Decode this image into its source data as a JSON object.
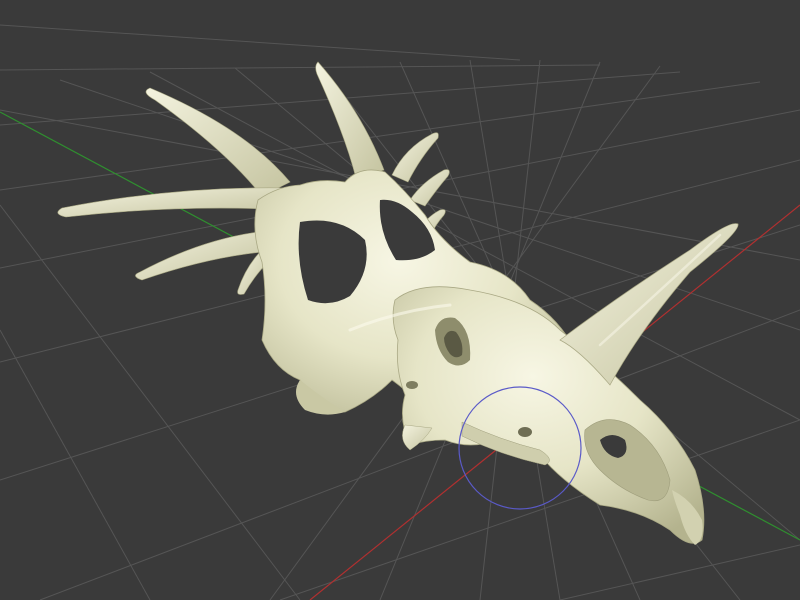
{
  "viewport": {
    "background_color": "#3a3a3a",
    "grid_line_color": "#555555",
    "grid_visible": true,
    "x_axis_color": "#b03030",
    "z_axis_color": "#2f8f2f",
    "model_color": "#e6e5c7",
    "model_shade_color": "#bcbb96",
    "model_highlight_color": "#f7f6e4",
    "rotate_gizmo_color": "#5a5ac8",
    "rotate_gizmo_icon": "orbit-circle"
  }
}
